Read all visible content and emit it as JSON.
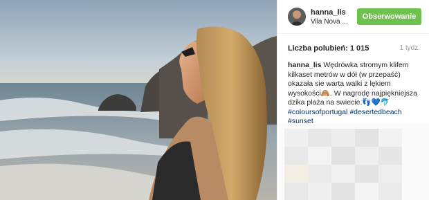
{
  "post": {
    "username": "hanna_lis",
    "location": "Vila Nova ...",
    "follow_label": "Obserwowanie",
    "likes_label": "Liczba polubień: 1 015",
    "time_ago": "1 tydz.",
    "caption_user": "hanna_lis",
    "caption_text": "Wędrówka stromym klifem kilkaset metrów w dół (w przepaść) okazała sie warta walki z lękiem wysokości🙈. W nagrodę najpiękniejsza dzika plaża na swiecie.👣💙🐬",
    "hashtags": [
      "#coloursofportugal",
      "#desertedbeach",
      "#sunset"
    ]
  },
  "colors": {
    "follow_bg": "#70c050",
    "hashtag": "#003569"
  },
  "icons": [
    "avatar-photo",
    "beach-sunset-photo"
  ]
}
